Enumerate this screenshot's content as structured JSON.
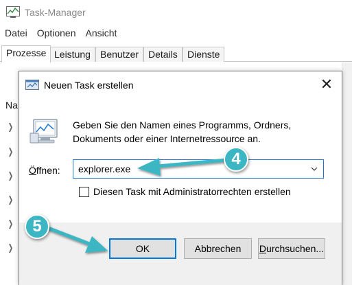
{
  "task_manager": {
    "title": "Task-Manager",
    "menu": [
      "Datei",
      "Optionen",
      "Ansicht"
    ],
    "tabs": [
      "Prozesse",
      "Leistung",
      "Benutzer",
      "Details",
      "Dienste"
    ],
    "active_tab": "Prozesse",
    "column_header": "Na"
  },
  "dialog": {
    "title": "Neuen Task erstellen",
    "close_symbol": "✕",
    "description": "Geben Sie den Namen eines Programms, Ordners, Dokuments oder einer Internetressource an.",
    "open_label_prefix": "Ö",
    "open_label_rest": "ffnen:",
    "open_value": "explorer.exe",
    "admin_checkbox_label": "Diesen Task mit Administratorrechten erstellen",
    "admin_checked": false,
    "buttons": {
      "ok": "OK",
      "cancel": "Abbrechen",
      "browse_prefix": "D",
      "browse_rest": "urchsuchen..."
    }
  },
  "callouts": {
    "step4": "4",
    "step5": "5"
  },
  "colors": {
    "callout": "#3db6c4",
    "focus_border": "#0078d7"
  }
}
